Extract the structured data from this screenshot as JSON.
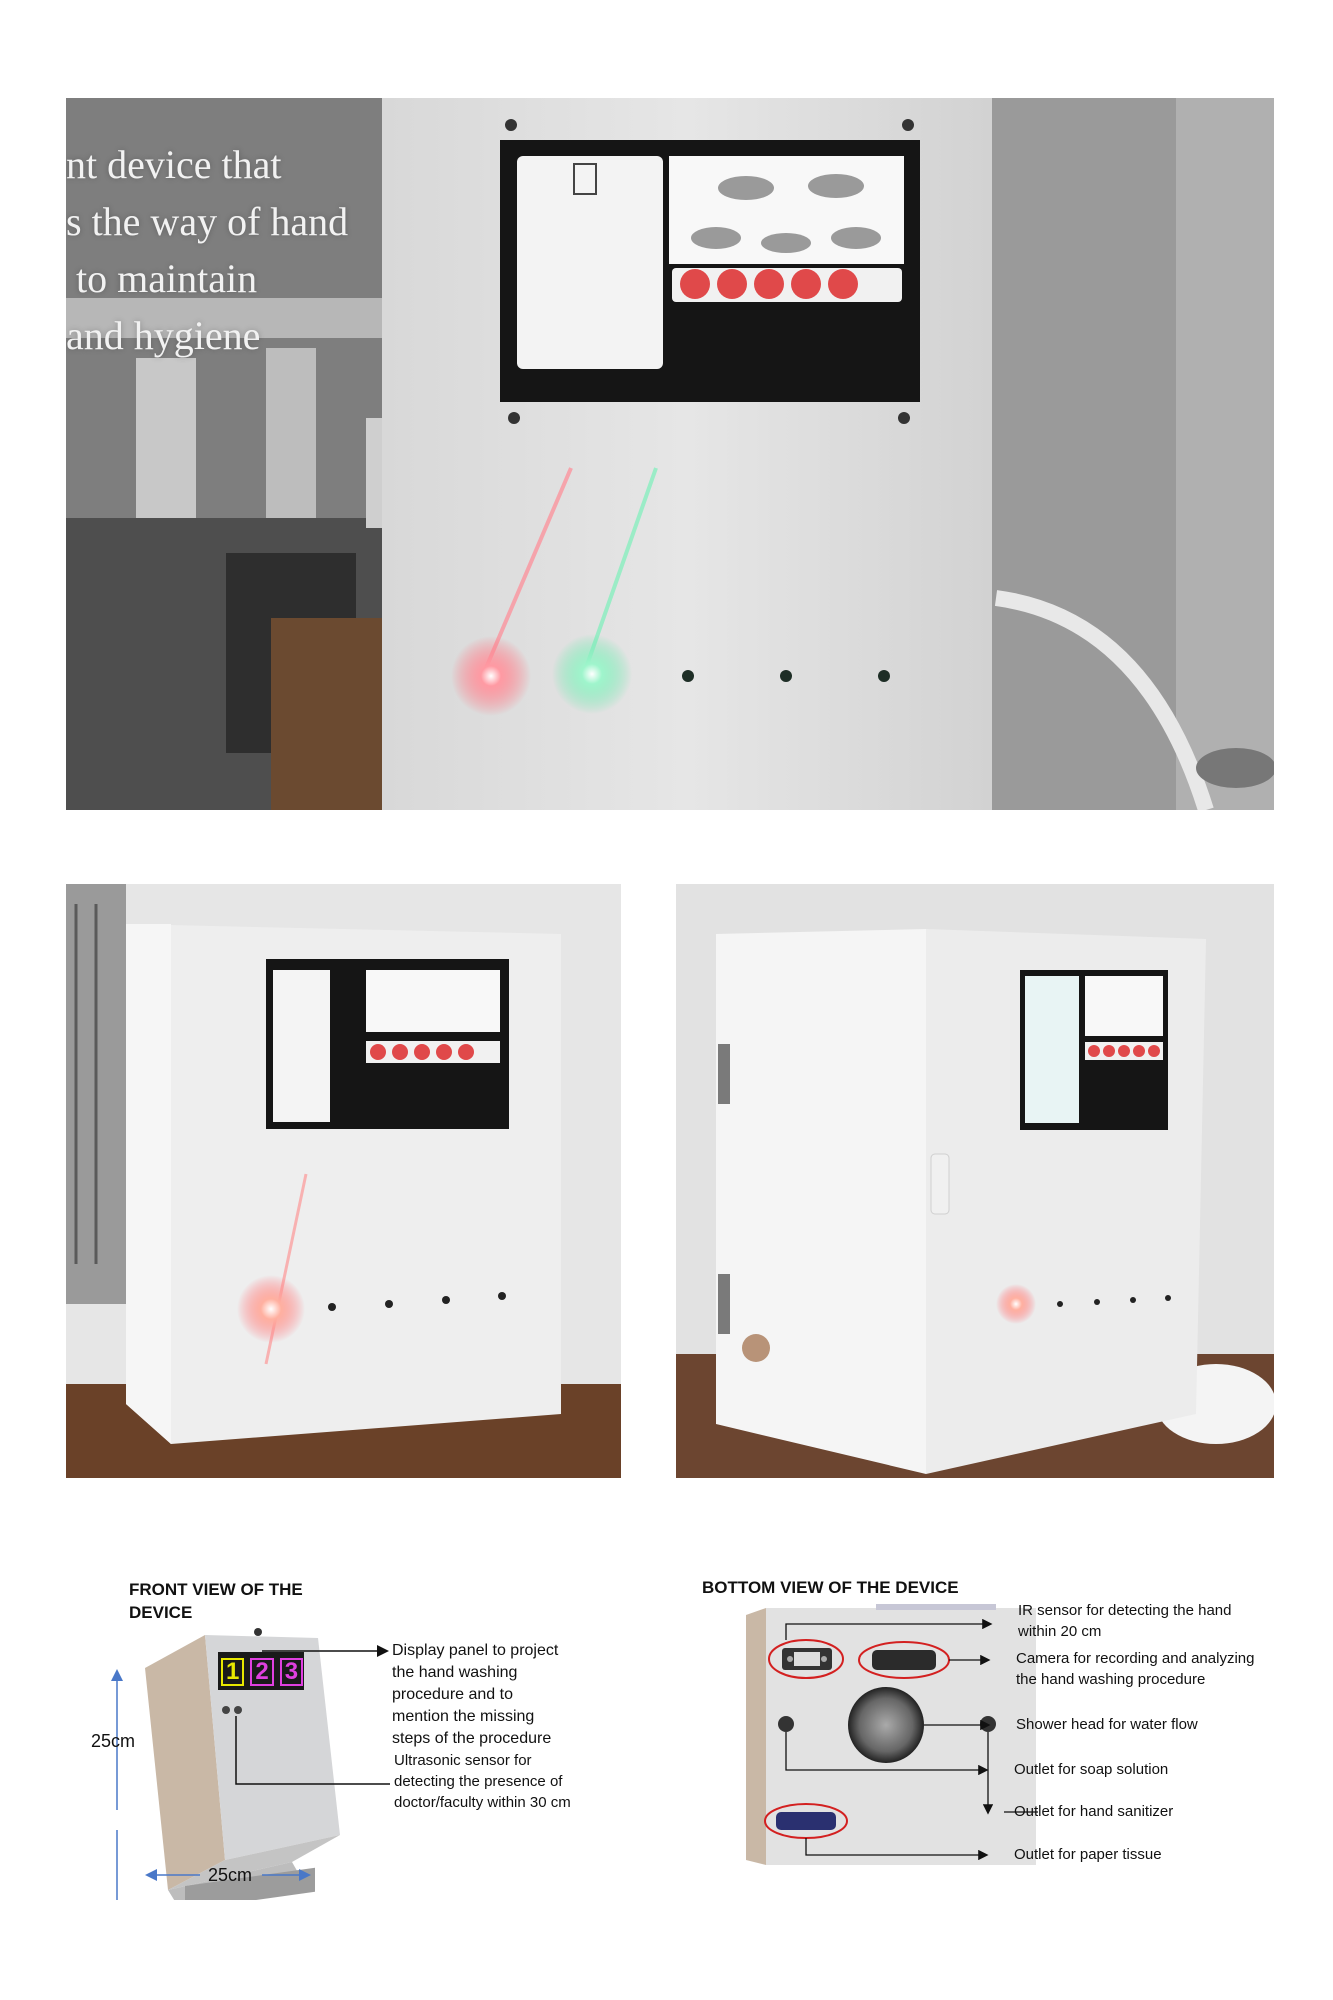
{
  "hero_overlay": {
    "lines": [
      "nt device that",
      "s the way of hand",
      "to maintain",
      "and hygiene"
    ]
  },
  "front_diagram": {
    "title_line1": "FRONT VIEW OF THE",
    "title_line2": "DEVICE",
    "display_digits": [
      "1",
      "2",
      "3"
    ],
    "display_annotation": [
      "Display panel to project",
      "the hand washing",
      "procedure and to",
      "mention the missing",
      "steps of the  procedure"
    ],
    "ultrasonic_annotation": [
      "Ultrasonic sensor for",
      "detecting the presence of",
      "doctor/faculty within 30 cm"
    ],
    "height_label": "25cm",
    "width_label": "25cm"
  },
  "bottom_diagram": {
    "title": "BOTTOM VIEW OF THE DEVICE",
    "ir_sensor": [
      "IR sensor for detecting the hand",
      "within 20 cm"
    ],
    "camera": [
      "Camera for recording and analyzing",
      "the hand washing procedure"
    ],
    "shower": "Shower head for water flow",
    "soap": "Outlet for soap solution",
    "sanitizer": "Outlet for hand sanitizer",
    "tissue": "Outlet for paper tissue"
  },
  "colors": {
    "led_red": "#ff6b78",
    "led_green": "#5fe6a6",
    "screen_dot_red": "#e0494a",
    "device_white": "#eeeeee",
    "digit_yellow": "#e8e800",
    "digit_magenta": "#e040e0",
    "annotation_red": "#d32020",
    "dimension_blue": "#4a78c8"
  }
}
